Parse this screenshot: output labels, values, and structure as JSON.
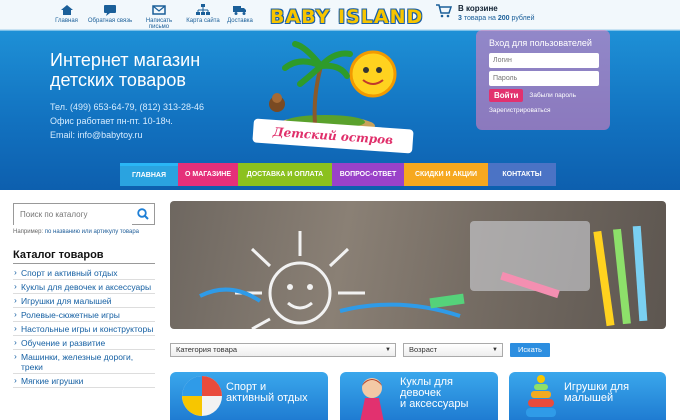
{
  "topnav": [
    {
      "label": "Главная",
      "icon": "home-icon"
    },
    {
      "label": "Обратная связь",
      "icon": "feedback-icon"
    },
    {
      "label": "Написать письмо",
      "icon": "mail-icon"
    },
    {
      "label": "Карта сайта",
      "icon": "sitemap-icon"
    },
    {
      "label": "Доставка",
      "icon": "delivery-icon"
    }
  ],
  "logo": "BABY ISLAND",
  "cart": {
    "title": "В корзине",
    "count": "3",
    "count_text": "товара на",
    "amount": "200",
    "currency": "рублей"
  },
  "shop_title": [
    "Интернет магазин",
    "детских товаров"
  ],
  "contacts": {
    "phone": "Тел. (499) 653-64-79, (812) 313-28-46",
    "hours": "Офис работает пн-пт. 10-18ч.",
    "email": "Email: info@babytoy.ru"
  },
  "ribbon": "Детский остров",
  "login": {
    "title": "Вход для пользователей",
    "login_placeholder": "Логин",
    "password_placeholder": "Пароль",
    "submit": "Войти",
    "forgot": "Забыли пароль",
    "register": "Зарегистрироваться"
  },
  "menu": [
    "ГЛАВНАЯ",
    "О МАГАЗИНЕ",
    "ДОСТАВКА И ОПЛАТА",
    "ВОПРОС-ОТВЕТ",
    "СКИДКИ И АКЦИИ",
    "КОНТАКТЫ"
  ],
  "search": {
    "placeholder": "Поиск по каталогу",
    "hint_prefix": "Например:",
    "hint_link": "по названию или артикулу товара"
  },
  "catalog": {
    "title": "Каталог товаров",
    "items": [
      "Спорт и активный отдых",
      "Куклы для девочек и аксессуары",
      "Игрушки для малышей",
      "Ролевые-сюжетные игры",
      "Настольные игры и конструкторы",
      "Обучение и развитие",
      "Машинки, железные дороги, треки",
      "Мягкие игрушки"
    ]
  },
  "filters": {
    "category": "Категория товара",
    "age": "Возраст",
    "button": "Искать"
  },
  "cards": [
    {
      "line1": "Спорт и",
      "line2": "активный отдых"
    },
    {
      "line1": "Куклы для",
      "line2": "девочек",
      "line3": "и аксессуары"
    },
    {
      "line1": "Игрушки для",
      "line2": "малышей"
    }
  ],
  "colors": {
    "menu_pink": "#e5307a",
    "menu_green": "#8bc11f",
    "menu_purple": "#9a42c9",
    "menu_orange": "#f6a81f",
    "menu_blue": "#4b73c5",
    "accent": "#2c8ee0"
  }
}
